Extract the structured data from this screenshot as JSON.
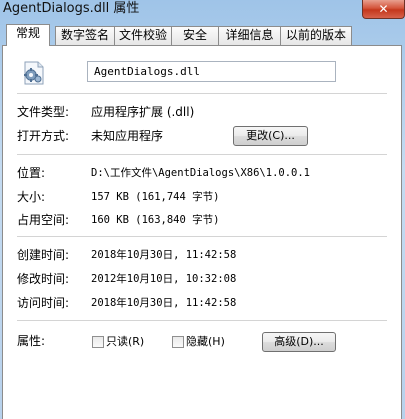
{
  "window": {
    "title": "AgentDialogs.dll 属性",
    "close_glyph": "✕"
  },
  "tabs": [
    {
      "label": "常规",
      "active": true
    },
    {
      "label": "数字签名"
    },
    {
      "label": "文件校验"
    },
    {
      "label": "安全"
    },
    {
      "label": "详细信息"
    },
    {
      "label": "以前的版本"
    }
  ],
  "file": {
    "icon": "dll-settings-file-icon",
    "name": "AgentDialogs.dll"
  },
  "general": {
    "type_label": "文件类型:",
    "type_value": "应用程序扩展 (.dll)",
    "open_label": "打开方式:",
    "open_value": "未知应用程序",
    "change_button": "更改(C)...",
    "location_label": "位置:",
    "location_value": "D:\\工作文件\\AgentDialogs\\X86\\1.0.0.1",
    "size_label": "大小:",
    "size_value": "157 KB (161,744 字节)",
    "disk_label": "占用空间:",
    "disk_value": "160 KB (163,840 字节)",
    "created_label": "创建时间:",
    "created_value": "2018年10月30日, 11:42:58",
    "modified_label": "修改时间:",
    "modified_value": "2012年10月10日, 10:32:08",
    "accessed_label": "访问时间:",
    "accessed_value": "2018年10月30日, 11:42:58",
    "attr_label": "属性:",
    "readonly_label": "只读(R)",
    "hidden_label": "隐藏(H)",
    "advanced_button": "高级(D)..."
  }
}
